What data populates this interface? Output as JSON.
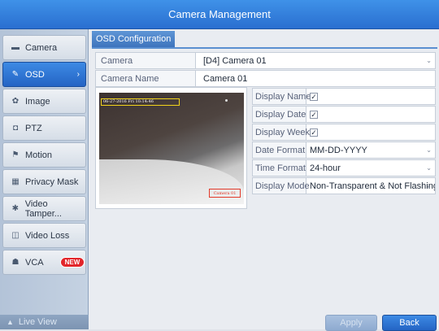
{
  "window": {
    "title": "Camera Management"
  },
  "sidebar": {
    "items": [
      {
        "label": "Camera",
        "icon": "camera-icon",
        "glyph": "▬"
      },
      {
        "label": "OSD",
        "icon": "pen-icon",
        "glyph": "✎",
        "chevron": "›"
      },
      {
        "label": "Image",
        "icon": "palette-icon",
        "glyph": "✿"
      },
      {
        "label": "PTZ",
        "icon": "ptz-icon",
        "glyph": "◘"
      },
      {
        "label": "Motion",
        "icon": "motion-icon",
        "glyph": "⚑"
      },
      {
        "label": "Privacy Mask",
        "icon": "mask-icon",
        "glyph": "▦"
      },
      {
        "label": "Video Tamper...",
        "icon": "tamper-icon",
        "glyph": "✱"
      },
      {
        "label": "Video Loss",
        "icon": "video-loss-icon",
        "glyph": "◫"
      },
      {
        "label": "VCA",
        "icon": "vca-icon",
        "glyph": "☗",
        "badge": "NEW"
      }
    ],
    "live_view": {
      "label": "Live View",
      "glyph": "▲"
    }
  },
  "main": {
    "tab": "OSD Configuration",
    "camera": {
      "label": "Camera",
      "value": "[D4] Camera 01"
    },
    "camera_name": {
      "label": "Camera Name",
      "value": "Camera 01"
    },
    "preview": {
      "osd_date": "06-27-2016 Fri 10:14:46",
      "osd_name": "Camera 01"
    },
    "options": {
      "display_name": {
        "label": "Display Name",
        "checked": true
      },
      "display_date": {
        "label": "Display Date",
        "checked": true
      },
      "display_week": {
        "label": "Display Week",
        "checked": true
      },
      "date_format": {
        "label": "Date Format",
        "value": "MM-DD-YYYY"
      },
      "time_format": {
        "label": "Time Format",
        "value": "24-hour"
      },
      "display_mode": {
        "label": "Display Mode",
        "value": "Non-Transparent & Not Flashing"
      }
    },
    "check_glyph": "✓",
    "dropdown_glyph": "⌄",
    "buttons": {
      "apply": "Apply",
      "back": "Back"
    }
  },
  "colors": {
    "accent": "#2a6fd0",
    "badge": "#e2262b",
    "osd_date_box": "#f2d31b",
    "osd_name_box": "#e23a2a"
  }
}
